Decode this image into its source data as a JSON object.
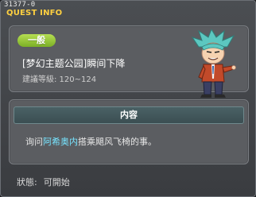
{
  "window": {
    "quest_id": "31377-0",
    "title": "QUEST INFO"
  },
  "quest": {
    "category": "一般",
    "name": "[梦幻主题公园]瞬间下降",
    "level_text": "建議等級: 120~124"
  },
  "content": {
    "header": "内容",
    "description_prefix": "询问",
    "description_npc": "阿希奥内",
    "description_suffix": "搭乘飓风飞椅的事。"
  },
  "status": {
    "label": "狀態:",
    "value": "可開始"
  },
  "npc": {
    "icon": "npc-portrait-icon",
    "hair_color": "#5cc7c0",
    "suit_color": "#c24a2a"
  },
  "colors": {
    "title": "#ffd040",
    "pill": "#9ccc3c",
    "highlight": "#77e4ff"
  }
}
